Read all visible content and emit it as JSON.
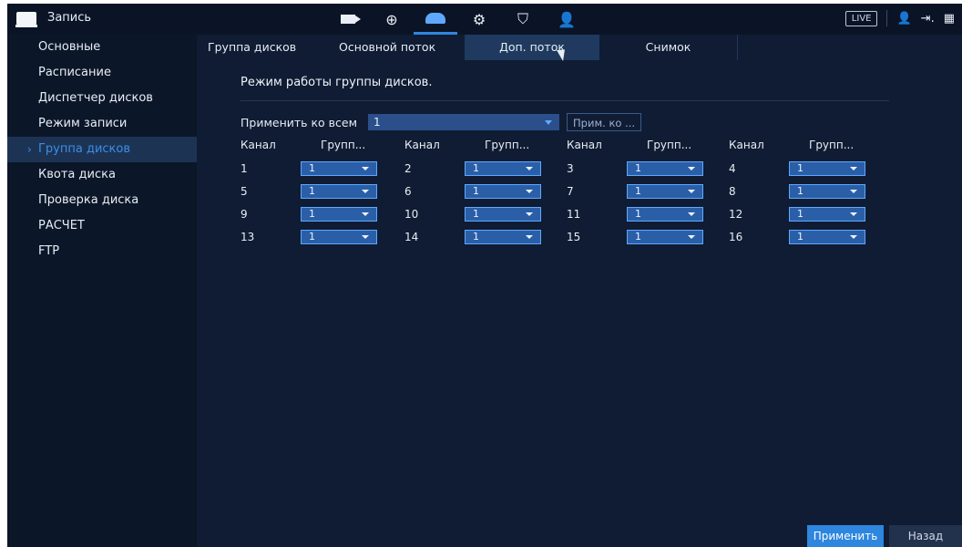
{
  "app": {
    "title": "Запись"
  },
  "topbar": {
    "icons": [
      "camera-icon",
      "globe-icon",
      "hdd-icon",
      "gears-icon",
      "shield-icon",
      "account-icon"
    ],
    "live_label": "LIVE"
  },
  "sidebar": {
    "items": [
      {
        "label": "Основные"
      },
      {
        "label": "Расписание"
      },
      {
        "label": "Диспетчер дисков"
      },
      {
        "label": "Режим записи"
      },
      {
        "label": "Группа дисков"
      },
      {
        "label": "Квота диска"
      },
      {
        "label": "Проверка диска"
      },
      {
        "label": "РАСЧЕТ"
      },
      {
        "label": "FTP"
      }
    ],
    "active_index": 4
  },
  "tabs": [
    {
      "label": "Группа дисков"
    },
    {
      "label": "Основной поток"
    },
    {
      "label": "Доп. поток"
    },
    {
      "label": "Снимок"
    }
  ],
  "main": {
    "section_title": "Режим работы группы дисков.",
    "apply_all_label": "Применить ко всем",
    "apply_all_value": "1",
    "apply_to_button": "Прим. ко ...",
    "col_channel": "Канал",
    "col_group": "Групп...",
    "rows": [
      [
        {
          "ch": "1",
          "grp": "1"
        },
        {
          "ch": "2",
          "grp": "1"
        },
        {
          "ch": "3",
          "grp": "1"
        },
        {
          "ch": "4",
          "grp": "1"
        }
      ],
      [
        {
          "ch": "5",
          "grp": "1"
        },
        {
          "ch": "6",
          "grp": "1"
        },
        {
          "ch": "7",
          "grp": "1"
        },
        {
          "ch": "8",
          "grp": "1"
        }
      ],
      [
        {
          "ch": "9",
          "grp": "1"
        },
        {
          "ch": "10",
          "grp": "1"
        },
        {
          "ch": "11",
          "grp": "1"
        },
        {
          "ch": "12",
          "grp": "1"
        }
      ],
      [
        {
          "ch": "13",
          "grp": "1"
        },
        {
          "ch": "14",
          "grp": "1"
        },
        {
          "ch": "15",
          "grp": "1"
        },
        {
          "ch": "16",
          "grp": "1"
        }
      ]
    ]
  },
  "footer": {
    "apply_label": "Применить",
    "back_label": "Назад"
  },
  "colors": {
    "background": "#0f1c33",
    "sidebar": "#0b1628",
    "accent": "#2e86de",
    "select": "#2a5fa8"
  }
}
